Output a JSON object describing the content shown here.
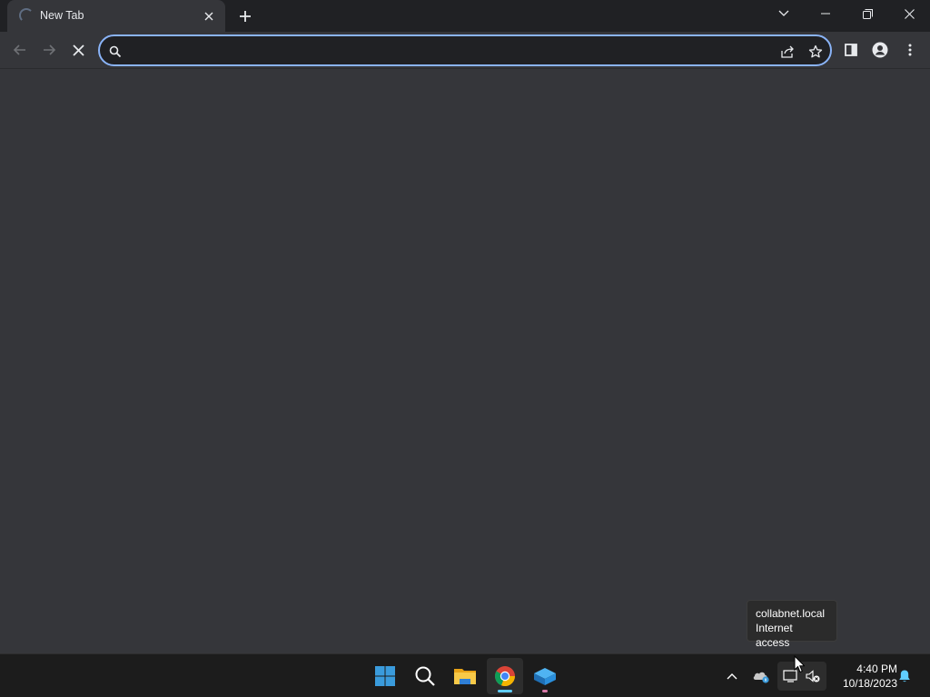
{
  "browser": {
    "tab": {
      "title": "New Tab"
    },
    "omnibox": {
      "value": "",
      "placeholder": ""
    }
  },
  "tooltip": {
    "line1": "collabnet.local",
    "line2": "Internet access"
  },
  "taskbar": {
    "clock_time": "4:40 PM",
    "clock_date": "10/18/2023"
  },
  "colors": {
    "accent": "#8ab4f8",
    "background": "#35363a",
    "tabstrip": "#202124",
    "taskbar": "#1c1c1c"
  }
}
